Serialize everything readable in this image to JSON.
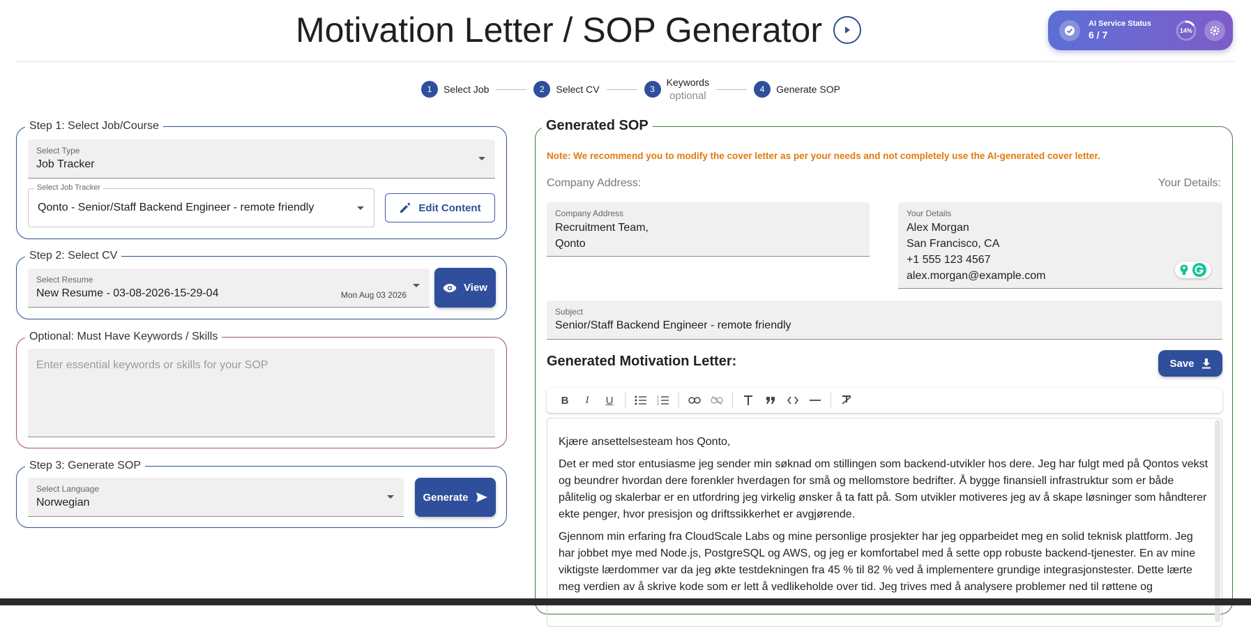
{
  "header": {
    "title": "Motivation Letter / SOP Generator",
    "ai_status": {
      "label": "AI Service Status",
      "value": "6 / 7",
      "progress_text": "14%",
      "progress_fraction": 0.14
    }
  },
  "stepper": {
    "steps": [
      {
        "number": "1",
        "label": "Select Job"
      },
      {
        "number": "2",
        "label": "Select CV"
      },
      {
        "number": "3",
        "label": "Keywords",
        "sub": "optional"
      },
      {
        "number": "4",
        "label": "Generate SOP"
      }
    ]
  },
  "step1": {
    "legend": "Step 1: Select Job/Course",
    "select_type": {
      "label": "Select Type",
      "value": "Job Tracker"
    },
    "job_tracker": {
      "label": "Select Job Tracker",
      "value": "Qonto - Senior/Staff Backend Engineer - remote friendly"
    },
    "edit_button": "Edit Content"
  },
  "step2": {
    "legend": "Step 2: Select CV",
    "resume": {
      "label": "Select Resume",
      "value": "New Resume - 03-08-2026-15-29-04",
      "date": "Mon Aug 03 2026"
    },
    "view_button": "View"
  },
  "keywords": {
    "legend": "Optional: Must Have Keywords / Skills",
    "placeholder": "Enter essential keywords or skills for your SOP"
  },
  "step3": {
    "legend": "Step 3: Generate SOP",
    "language": {
      "label": "Select Language",
      "value": "Norwegian"
    },
    "generate_button": "Generate"
  },
  "sop": {
    "legend": "Generated SOP",
    "note": "Note: We recommend you to modify the cover letter as per your needs and not completely use the AI-generated cover letter.",
    "company_heading": "Company Address:",
    "details_heading": "Your Details:",
    "company_address": {
      "label": "Company Address",
      "value": "Recruitment Team,\nQonto"
    },
    "your_details": {
      "label": "Your Details",
      "value": "Alex Morgan\nSan Francisco, CA\n+1 555 123 4567\nalex.morgan@example.com"
    },
    "subject": {
      "label": "Subject",
      "value": "Senior/Staff Backend Engineer - remote friendly"
    },
    "letter_title": "Generated Motivation Letter:",
    "save_button": "Save",
    "letter_paragraphs": [
      "Kjære ansettelsesteam hos Qonto,",
      "Det er med stor entusiasme jeg sender min søknad om stillingen som backend-utvikler hos dere. Jeg har fulgt med på Qontos vekst og beundrer hvordan dere forenkler hverdagen for små og mellomstore bedrifter. Å bygge finansiell infrastruktur som er både pålitelig og skalerbar er en utfordring jeg virkelig ønsker å ta fatt på. Som utvikler motiveres jeg av å skape løsninger som håndterer ekte penger, hvor presisjon og driftssikkerhet er avgjørende.",
      "Gjennom min erfaring fra CloudScale Labs og mine personlige prosjekter har jeg opparbeidet meg en solid teknisk plattform. Jeg har jobbet mye med Node.js, PostgreSQL og AWS, og jeg er komfortabel med å sette opp robuste backend-tjenester. En av mine viktigste lærdommer var da jeg økte testdekningen fra 45 % til 82 % ved å implementere grundige integrasjonstester. Dette lærte meg verdien av å skrive kode som er lett å vedlikeholde over tid. Jeg trives med å analysere problemer ned til røttene og"
    ]
  },
  "colors": {
    "primary": "#2f4f9c",
    "note": "#e07a10",
    "sop_border": "#3f7a3a",
    "keywords_border": "#a0506a"
  }
}
